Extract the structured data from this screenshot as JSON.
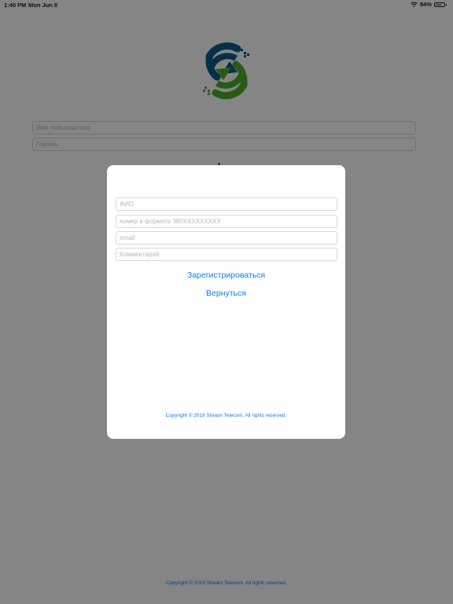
{
  "status_bar": {
    "time": "1:40 PM",
    "date": "Mon Jun 8",
    "battery_percent": "84%",
    "battery_level": 0.84,
    "wifi_icon": "wifi-icon",
    "battery_icon": "battery-charging-icon"
  },
  "login": {
    "username_placeholder": "Имя пользователя",
    "password_placeholder": "Пароль",
    "footer": "Copyright © 2019 Stream Telecom. All rights reserved."
  },
  "registration_modal": {
    "fields": {
      "name_placeholder": "ФИО",
      "phone_placeholder": "номер в формате 380XXXXXXXXX",
      "email_placeholder": "email",
      "comment_placeholder": "Комментарий"
    },
    "register_label": "Зарегистрироваться",
    "back_label": "Вернуться",
    "footer": "Copyright © 2019 Stream Telecom. All rights reserved."
  },
  "colors": {
    "accent": "#0a7cff",
    "logo_blue": "#0e5a8a",
    "logo_green": "#4caf2a",
    "overlay": "rgba(0,0,0,0.48)"
  }
}
